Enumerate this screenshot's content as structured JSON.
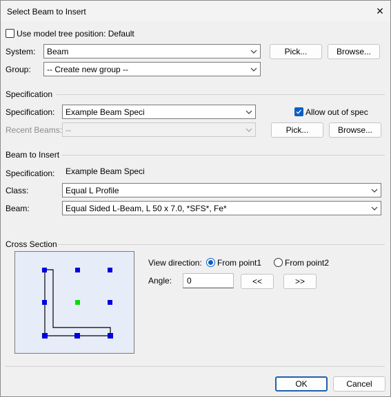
{
  "window": {
    "title": "Select Beam to Insert"
  },
  "top": {
    "use_model_tree_label": "Use model tree position: Default",
    "use_model_tree_checked": false,
    "system_label": "System:",
    "system_value": "Beam",
    "group_label": "Group:",
    "group_value": "-- Create new group --",
    "pick_label": "Pick...",
    "browse_label": "Browse..."
  },
  "specification": {
    "section_title": "Specification",
    "spec_label": "Specification:",
    "spec_value": "Example Beam Speci",
    "recent_label": "Recent Beams:",
    "recent_value": "--",
    "allow_out_of_spec_label": "Allow out of spec",
    "allow_out_of_spec_checked": true,
    "pick_label": "Pick...",
    "browse_label": "Browse..."
  },
  "beam_to_insert": {
    "section_title": "Beam to Insert",
    "spec_label": "Specification:",
    "spec_value": "Example Beam Speci",
    "class_label": "Class:",
    "class_value": "Equal L Profile",
    "beam_label": "Beam:",
    "beam_value": "Equal Sided L-Beam, L 50 x 7.0, *SFS*, Fe*"
  },
  "cross_section": {
    "section_title": "Cross Section",
    "view_direction_label": "View direction:",
    "from_point1_label": "From point1",
    "from_point2_label": "From point2",
    "selected_direction": "From point1",
    "angle_label": "Angle:",
    "angle_value": "0",
    "rotate_left_label": "<<",
    "rotate_right_label": ">>"
  },
  "footer": {
    "ok_label": "OK",
    "cancel_label": "Cancel"
  },
  "colors": {
    "accent": "#0a5fc4",
    "handle": "#0000e0",
    "center_handle": "#00e000",
    "preview_bg": "#e7edf8"
  }
}
